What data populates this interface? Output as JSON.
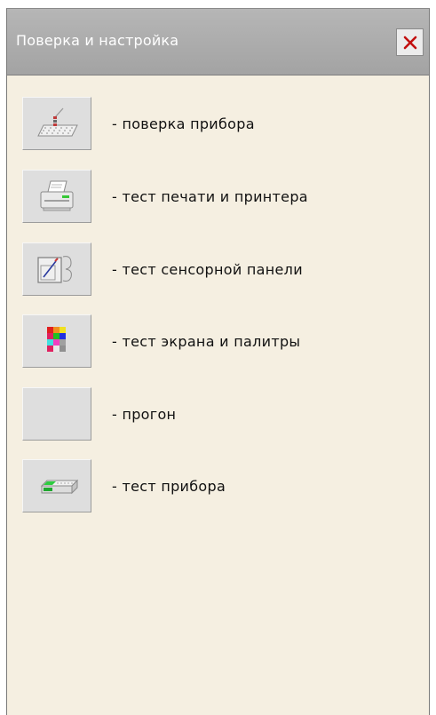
{
  "window": {
    "title": "Поверка и настройка",
    "close_label": "close"
  },
  "items": [
    {
      "label": "- поверка прибора",
      "icon": "calibration-icon"
    },
    {
      "label": "- тест печати и принтера",
      "icon": "printer-icon"
    },
    {
      "label": "- тест сенсорной панели",
      "icon": "touch-panel-icon"
    },
    {
      "label": "- тест экрана и палитры",
      "icon": "palette-icon"
    },
    {
      "label": "- прогон",
      "icon": ""
    },
    {
      "label": "- тест прибора",
      "icon": "device-icon"
    }
  ]
}
